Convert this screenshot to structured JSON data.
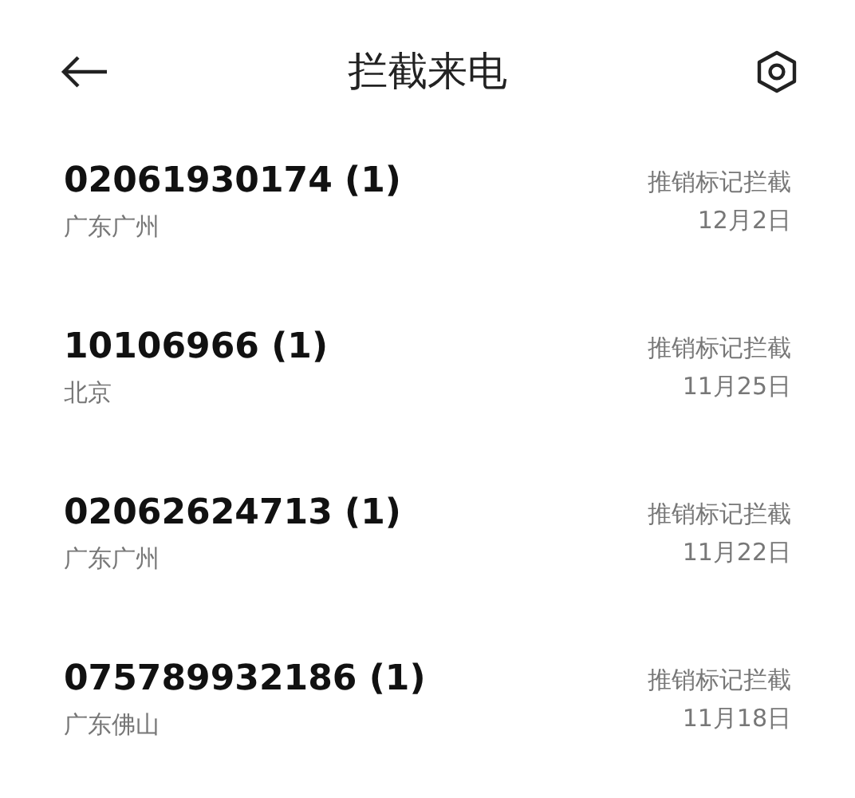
{
  "header": {
    "title": "拦截来电"
  },
  "calls": [
    {
      "number": "02061930174 (1)",
      "location": "广东广州",
      "reason": "推销标记拦截",
      "date": "12月2日"
    },
    {
      "number": "10106966 (1)",
      "location": "北京",
      "reason": "推销标记拦截",
      "date": "11月25日"
    },
    {
      "number": "02062624713 (1)",
      "location": "广东广州",
      "reason": "推销标记拦截",
      "date": "11月22日"
    },
    {
      "number": "075789932186 (1)",
      "location": "广东佛山",
      "reason": "推销标记拦截",
      "date": "11月18日"
    }
  ]
}
